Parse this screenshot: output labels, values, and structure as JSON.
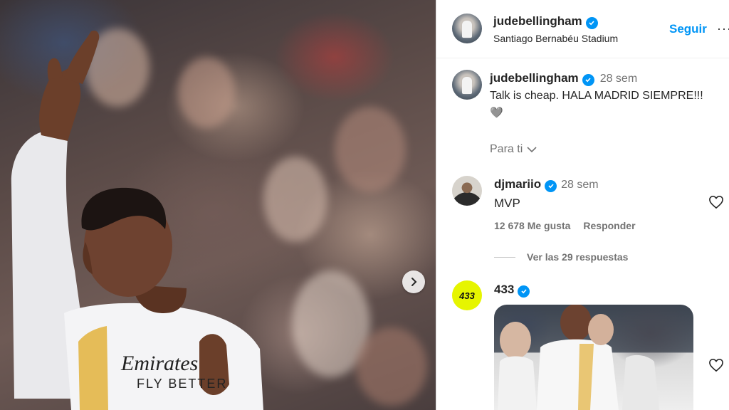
{
  "post": {
    "username": "judebellingham",
    "location": "Santiago Bernabéu Stadium",
    "follow_label": "Seguir",
    "more_label": "···",
    "caption_time": "28 sem",
    "caption": "Talk is cheap. HALA MADRID SIEMPRE!!!",
    "caption_emoji": "🩶",
    "translate_label": "Para ti"
  },
  "shirt": {
    "sponsor_line1": "Emirates",
    "sponsor_line2": "FLY BETTER"
  },
  "comments": [
    {
      "username": "djmariio",
      "time": "28 sem",
      "text": "MVP",
      "likes": "12 678 Me gusta",
      "reply_label": "Responder",
      "view_replies": "Ver las 29 respuestas"
    },
    {
      "username": "433",
      "avatar_text": "433"
    }
  ],
  "colors": {
    "accent": "#0095f6",
    "verified": "#0095f6",
    "avatar_433": "#e6f500"
  },
  "icons": [
    "verified-badge-icon",
    "chevron-down-icon",
    "heart-icon",
    "chevron-right-icon",
    "more-icon"
  ]
}
